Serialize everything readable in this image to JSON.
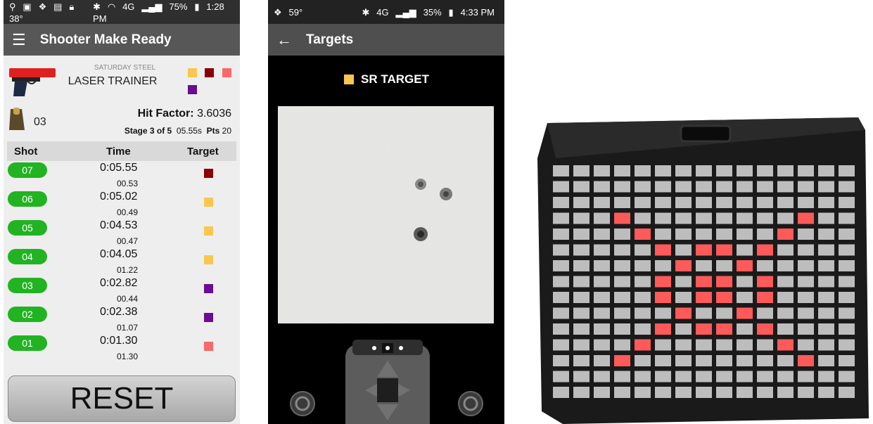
{
  "phone1": {
    "status": {
      "temp": "38°",
      "battery": "75%",
      "time": "1:28 PM",
      "network": "4G"
    },
    "appbar": {
      "title": "Shooter Make Ready"
    },
    "event": "SATURDAY STEEL",
    "trainer": "LASER TRAINER",
    "magazine_count": "03",
    "hit_factor_label": "Hit Factor:",
    "hit_factor_value": "3.6036",
    "stage_label": "Stage 3 of 5",
    "stage_time": "05.55s",
    "pts_label": "Pts",
    "pts_value": "20",
    "table": {
      "col_shot": "Shot",
      "col_time": "Time",
      "col_target": "Target"
    },
    "shots": [
      {
        "num": "07",
        "time": "0:05.55",
        "split": "00.53",
        "color": "#8b0000"
      },
      {
        "num": "06",
        "time": "0:05.02",
        "split": "00.49",
        "color": "#f9c74f"
      },
      {
        "num": "05",
        "time": "0:04.53",
        "split": "00.47",
        "color": "#f9c74f"
      },
      {
        "num": "04",
        "time": "0:04.05",
        "split": "01.22",
        "color": "#f9c74f"
      },
      {
        "num": "03",
        "time": "0:02.82",
        "split": "00.44",
        "color": "#6a0d91"
      },
      {
        "num": "02",
        "time": "0:02.38",
        "split": "01.07",
        "color": "#6a0d91"
      },
      {
        "num": "01",
        "time": "0:01.30",
        "split": "01.30",
        "color": "#f76a6a"
      }
    ],
    "legend_colors": [
      "#f9c74f",
      "#8b0000",
      "#f76a6a",
      "#6a0d91"
    ],
    "reset_label": "RESET"
  },
  "phone2": {
    "status": {
      "temp": "59°",
      "battery": "35%",
      "time": "4:33 PM",
      "network": "4G"
    },
    "appbar": {
      "title": "Targets"
    },
    "target_name": "SR TARGET",
    "target_color": "#f9c74f"
  },
  "panel": {
    "lit_color": "#ff5a5a",
    "off_color": "#bdbdbd"
  }
}
